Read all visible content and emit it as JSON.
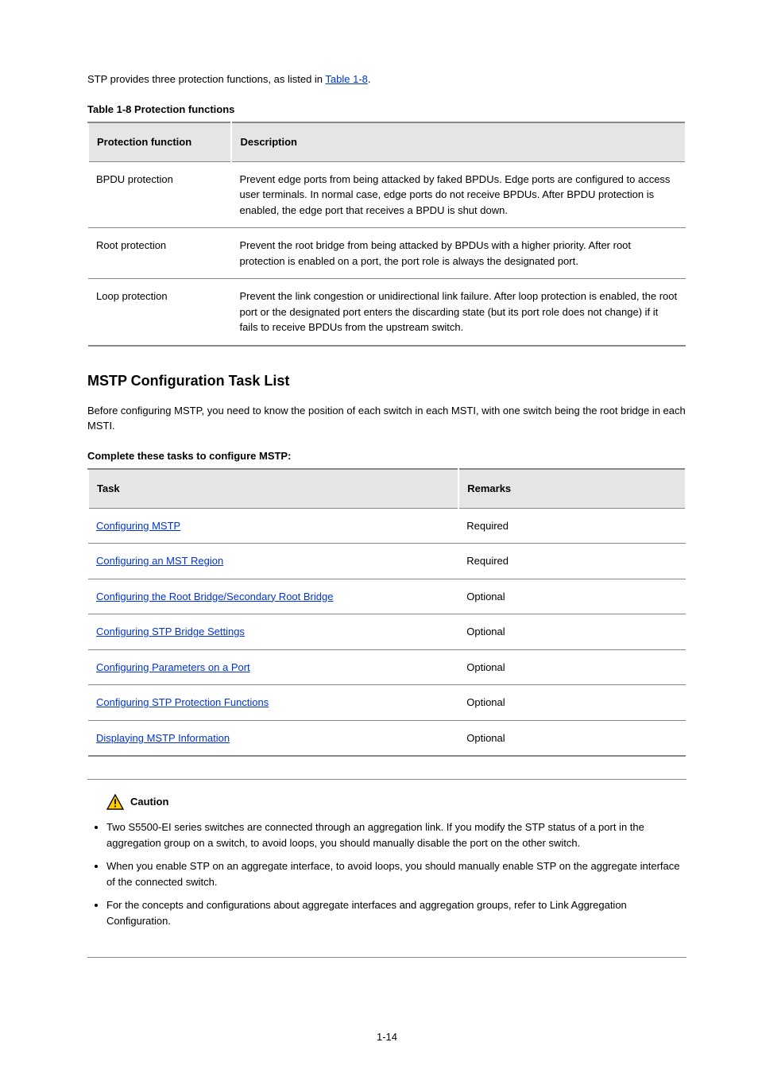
{
  "intro": {
    "text_before_link": "STP provides three protection functions, as listed in ",
    "link_text": "Table 1-8",
    "text_after_link": "."
  },
  "table1": {
    "caption": "Table 1-8 Protection functions",
    "headers": [
      "Protection function",
      "Description"
    ],
    "rows": [
      {
        "c1": "BPDU protection",
        "c2": "Prevent edge ports from being attacked by faked BPDUs. Edge ports are configured to access user terminals. In normal case, edge ports do not receive BPDUs. After BPDU protection is enabled, the edge port that receives a BPDU is shut down."
      },
      {
        "c1": "Root protection",
        "c2": "Prevent the root bridge from being attacked by BPDUs with a higher priority. After root protection is enabled on a port, the port role is always the designated port."
      },
      {
        "c1": "Loop protection",
        "c2": "Prevent the link congestion or unidirectional link failure. After loop protection is enabled, the root port or the designated port enters the discarding state (but its port role does not change) if it fails to receive BPDUs from the upstream switch."
      }
    ]
  },
  "section_heading": "MSTP Configuration Task List",
  "section_intro": "Before configuring MSTP, you need to know the position of each switch in each MSTI, with one switch being the root bridge in each MSTI.",
  "table2": {
    "caption": "Complete these tasks to configure MSTP:",
    "headers": [
      "Task",
      "Remarks"
    ],
    "rows": [
      {
        "link": "Configuring MSTP",
        "rest": "",
        "remarks": "Required"
      },
      {
        "link": "Configuring an MST Region",
        "rest": "",
        "remarks": "Required"
      },
      {
        "link": "Configuring the Root Bridge/Secondary Root Bridge",
        "rest": "",
        "remarks": "Optional"
      },
      {
        "link": "Configuring STP Bridge Settings",
        "rest": "",
        "remarks": "Optional"
      },
      {
        "link": "Configuring Parameters on a Port",
        "rest": "",
        "remarks": "Optional"
      },
      {
        "link": "Configuring STP Protection Functions",
        "rest": "",
        "remarks": "Optional"
      },
      {
        "link": "Displaying MSTP Information",
        "rest": "",
        "remarks": "Optional"
      }
    ]
  },
  "caution": {
    "label": "Caution",
    "items": [
      "Two S5500-EI series switches are connected through an aggregation link. If you modify the STP status of a port in the aggregation group on a switch, to avoid loops, you should manually disable the port on the other switch.",
      "When you enable STP on an aggregate interface, to avoid loops, you should manually enable STP on the aggregate interface of the connected switch.",
      "For the concepts and configurations about aggregate interfaces and aggregation groups, refer to Link Aggregation Configuration."
    ]
  },
  "page_number": "1-14"
}
